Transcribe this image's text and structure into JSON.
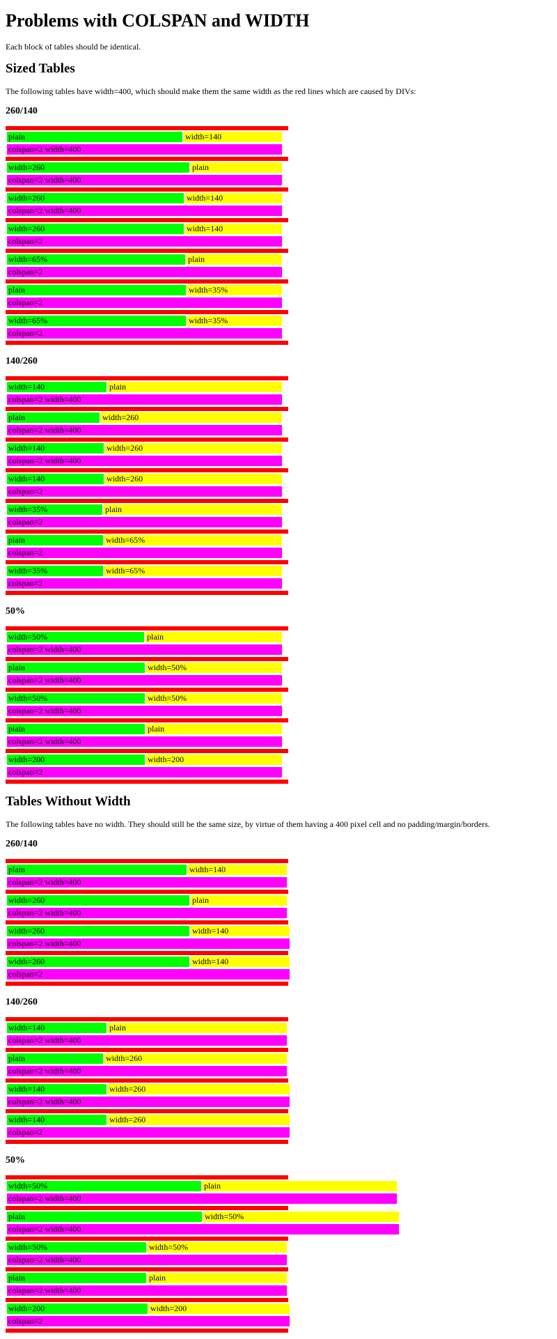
{
  "title": "Problems with COLSPAN and WIDTH",
  "intro": "Each block of tables should be identical.",
  "sections": [
    {
      "heading": "Sized Tables",
      "description": "The following tables have width=400, which should make them the same width as the red lines which are caused by DIVs:",
      "groups": [
        {
          "heading": "260/140",
          "tables": [
            {
              "left": "plain",
              "right": "width=140",
              "bottom": "colspan=2 width=400"
            },
            {
              "left": "width=260",
              "right": "plain",
              "bottom": "colspan=2 width=400"
            },
            {
              "left": "width=260",
              "right": "width=140",
              "bottom": "colspan=2 width=400"
            },
            {
              "left": "width=260",
              "right": "width=140",
              "bottom": "colspan=2"
            },
            {
              "left": "width=65%",
              "right": "plain",
              "bottom": "colspan=2"
            },
            {
              "left": "plain",
              "right": "width=35%",
              "bottom": "colspan=2"
            },
            {
              "left": "width=65%",
              "right": "width=35%",
              "bottom": "colspan=2"
            }
          ]
        },
        {
          "heading": "140/260",
          "tables": [
            {
              "left": "width=140",
              "right": "plain",
              "bottom": "colspan=2 width=400"
            },
            {
              "left": "plain",
              "right": "width=260",
              "bottom": "colspan=2 width=400"
            },
            {
              "left": "width=140",
              "right": "width=260",
              "bottom": "colspan=2 width=400"
            },
            {
              "left": "width=140",
              "right": "width=260",
              "bottom": "colspan=2"
            },
            {
              "left": "width=35%",
              "right": "plain",
              "bottom": "colspan=2"
            },
            {
              "left": "plain",
              "right": "width=65%",
              "bottom": "colspan=2"
            },
            {
              "left": "width=35%",
              "right": "width=65%",
              "bottom": "colspan=2"
            }
          ]
        },
        {
          "heading": "50%",
          "tables": [
            {
              "left": "width=50%",
              "right": "plain",
              "bottom": "colspan=2 width=400"
            },
            {
              "left": "plain",
              "right": "width=50%",
              "bottom": "colspan=2 width=400"
            },
            {
              "left": "width=50%",
              "right": "width=50%",
              "bottom": "colspan=2 width=400"
            },
            {
              "left": "plain",
              "right": "plain",
              "bottom": "colspan=2 width=400"
            },
            {
              "left": "width=200",
              "right": "width=200",
              "bottom": "colspan=2"
            }
          ]
        }
      ]
    },
    {
      "heading": "Tables Without Width",
      "description": "The following tables have no width. They should still be the same size, by virtue of them having a 400 pixel cell and no padding/margin/borders.",
      "groups": [
        {
          "heading": "260/140",
          "tables": [
            {
              "left": "plain",
              "right": "width=140",
              "bottom": "colspan=2 width=400"
            },
            {
              "left": "width=260",
              "right": "plain",
              "bottom": "colspan=2 width=400"
            },
            {
              "left": "width=260",
              "right": "width=140",
              "bottom": "colspan=2 width=400"
            },
            {
              "left": "width=260",
              "right": "width=140",
              "bottom": "colspan=2"
            }
          ]
        },
        {
          "heading": "140/260",
          "tables": [
            {
              "left": "width=140",
              "right": "plain",
              "bottom": "colspan=2 width=400"
            },
            {
              "left": "plain",
              "right": "width=260",
              "bottom": "colspan=2 width=400"
            },
            {
              "left": "width=140",
              "right": "width=260",
              "bottom": "colspan=2 width=400"
            },
            {
              "left": "width=140",
              "right": "width=260",
              "bottom": "colspan=2"
            }
          ]
        },
        {
          "heading": "50%",
          "tables": [
            {
              "left": "width=50%",
              "right": "plain",
              "bottom": "colspan=2 width=400"
            },
            {
              "left": "plain",
              "right": "width=50%",
              "bottom": "colspan=2 width=400"
            },
            {
              "left": "width=50%",
              "right": "width=50%",
              "bottom": "colspan=2 width=400"
            },
            {
              "left": "plain",
              "right": "plain",
              "bottom": "colspan=2 width=400"
            },
            {
              "left": "width=200",
              "right": "width=200",
              "bottom": "colspan=2"
            }
          ]
        }
      ]
    }
  ],
  "colors": {
    "red_line": "#ff0000",
    "left_cell": "#00ff00",
    "right_cell": "#ffff00",
    "colspan_cell": "#ff00ff"
  }
}
